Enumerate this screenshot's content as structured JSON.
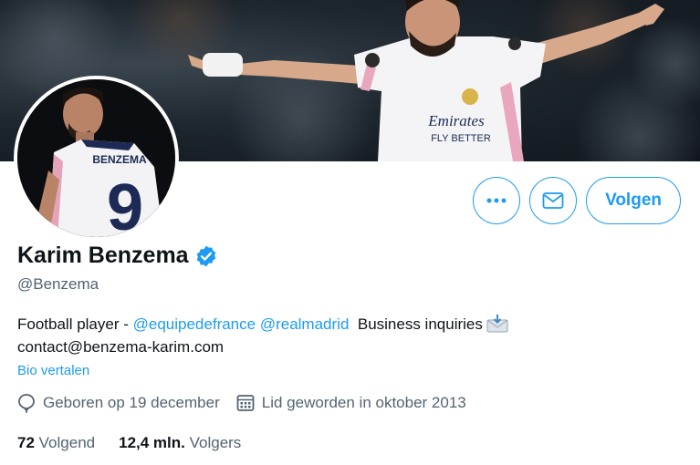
{
  "profile": {
    "name": "Karim Benzema",
    "handle": "@Benzema",
    "verified": true,
    "bio": {
      "prefix": "Football player - ",
      "mention1": "@equipedefrance",
      "mention2": "@realmadrid",
      "suffix": "Business inquiries",
      "email": "contact@benzema-karim.com"
    },
    "translate_label": "Bio vertalen",
    "birthday": "Geboren op 19 december",
    "joined": "Lid geworden in oktober 2013",
    "following_count": "72",
    "following_label": "Volgend",
    "followers_count": "12,4 mln.",
    "followers_label": "Volgers"
  },
  "actions": {
    "follow_label": "Volgen",
    "more_icon": "more-dots-icon",
    "message_icon": "envelope-icon"
  },
  "banner": {
    "jersey_sponsor": "Emirates",
    "jersey_sponsor_line2": "FLY BETTER"
  },
  "avatar": {
    "jersey_name": "BENZEMA",
    "jersey_number": "9"
  },
  "colors": {
    "accent": "#1d9bf0",
    "text": "#0f1419",
    "muted": "#536471"
  }
}
